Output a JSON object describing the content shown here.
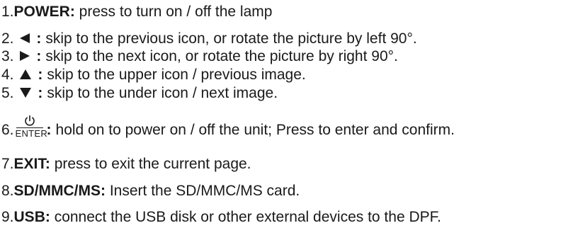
{
  "items": [
    {
      "num": "1.",
      "key": "POWER:",
      "text": " press to turn on / off  the lamp"
    },
    {
      "num": "2.",
      "key": ":",
      "text": "skip to the previous icon, or rotate the picture by left 90°."
    },
    {
      "num": "3.",
      "key": ":",
      "text": "skip to the next icon, or rotate the picture by right 90°."
    },
    {
      "num": "4.",
      "key": ":",
      "text": "skip to the upper icon / previous image."
    },
    {
      "num": "5.",
      "key": ":",
      "text": "skip to the under icon / next image."
    },
    {
      "num": "6.",
      "enter_label": "ENTER",
      "key": ":",
      "text": "hold on to power on / off the unit;  Press to enter and confirm."
    },
    {
      "num": "7.",
      "key": "EXIT:",
      "text": " press to exit the current page."
    },
    {
      "num": "8.",
      "key": "SD/MMC/MS:",
      "text": " Insert the SD/MMC/MS card."
    },
    {
      "num": "9.",
      "key": "USB:",
      "text": " connect the USB disk or other external devices to the DPF."
    }
  ],
  "icons": {
    "item2": "left-triangle-icon",
    "item3": "right-triangle-icon",
    "item4": "up-triangle-icon",
    "item5": "down-triangle-icon",
    "item6": "power-icon"
  },
  "colors": {
    "text": "#1a1a1a",
    "background": "#ffffff"
  }
}
